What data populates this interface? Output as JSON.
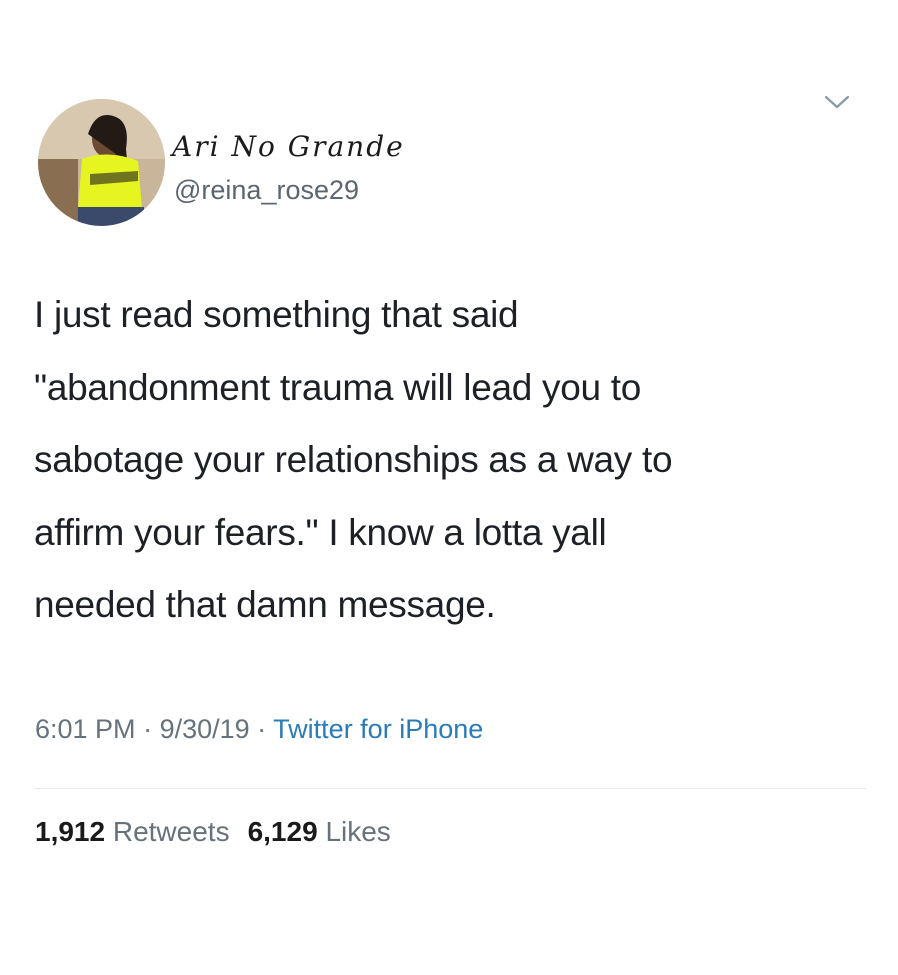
{
  "tweet": {
    "author": {
      "display_name": "Ari No Grande",
      "handle": "@reina_rose29",
      "avatar_icon": "profile-photo"
    },
    "menu_icon": "chevron-down-icon",
    "text_lines": [
      "I just read something that said",
      "\"abandonment trauma will lead you to",
      "sabotage your relationships as a way to",
      "affirm your fears.\" I know a lotta yall",
      "needed that damn message."
    ],
    "meta": {
      "time": "6:01 PM",
      "separator": " · ",
      "date": "9/30/19",
      "source": "Twitter for iPhone"
    },
    "stats": {
      "retweets_count": "1,912",
      "retweets_label": "Retweets",
      "likes_count": "6,129",
      "likes_label": "Likes"
    }
  },
  "colors": {
    "text": "#1d2127",
    "muted": "#66727c",
    "link": "#2b7bb9",
    "divider": "#e6ecf0"
  }
}
